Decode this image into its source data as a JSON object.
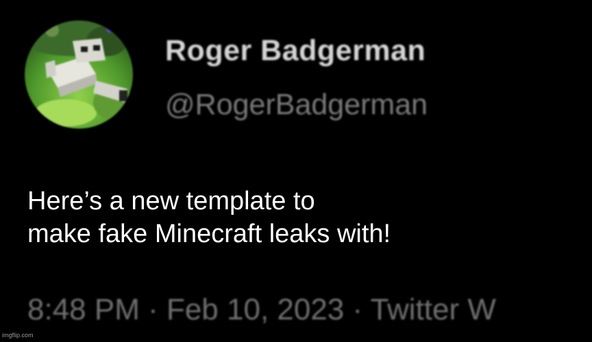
{
  "tweet": {
    "display_name": "Roger Badgerman",
    "handle": "@RogerBadgerman",
    "body": "Here’s a new template to\nmake fake Minecraft leaks with!",
    "meta_line": "8:48 PM · Feb 10, 2023 · Twitter W",
    "avatar_icon": "avatar-blocky-creature-on-grass"
  },
  "watermark": "imgflip.com",
  "colors": {
    "background": "#000000",
    "display_name": "#d6d6d6",
    "handle": "#7a7a7a",
    "meta": "#6f6f6f",
    "body_text": "#ffffff"
  }
}
